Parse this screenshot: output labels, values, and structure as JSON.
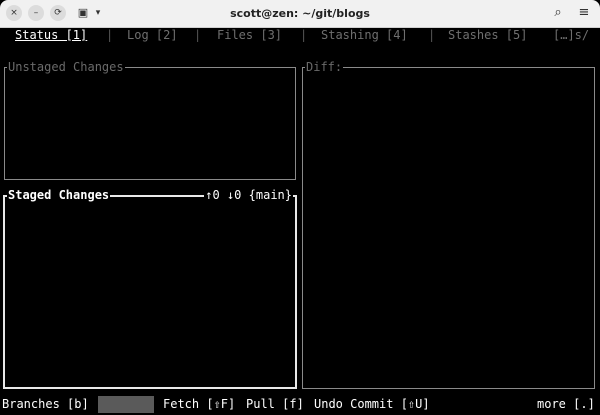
{
  "window": {
    "title": "scott@zen: ~/git/blogs",
    "buttons": {
      "close": "×",
      "minimize": "–",
      "reload": "⟳",
      "menu": "≡",
      "search": "⌕",
      "terminal": "▣",
      "dropdown": "▾"
    }
  },
  "tabs": [
    {
      "label": "Status [1]"
    },
    {
      "label": "Log [2]"
    },
    {
      "label": "Files [3]"
    },
    {
      "label": "Stashing [4]"
    },
    {
      "label": "Stashes [5]"
    }
  ],
  "tab_separator": "|",
  "tabs_overflow": "[…]s/",
  "panes": {
    "unstaged": {
      "title": "Unstaged Changes"
    },
    "staged": {
      "title": "Staged Changes",
      "ahead": "↑0",
      "behind": "↓0",
      "branch": "{main}"
    },
    "diff": {
      "title": "Diff:"
    }
  },
  "statusbar": {
    "branches": "Branches [b]",
    "fetch": "Fetch [⇧F]",
    "pull": "Pull [f]",
    "undo": "Undo Commit [⇧U]",
    "more": "more [.]"
  }
}
